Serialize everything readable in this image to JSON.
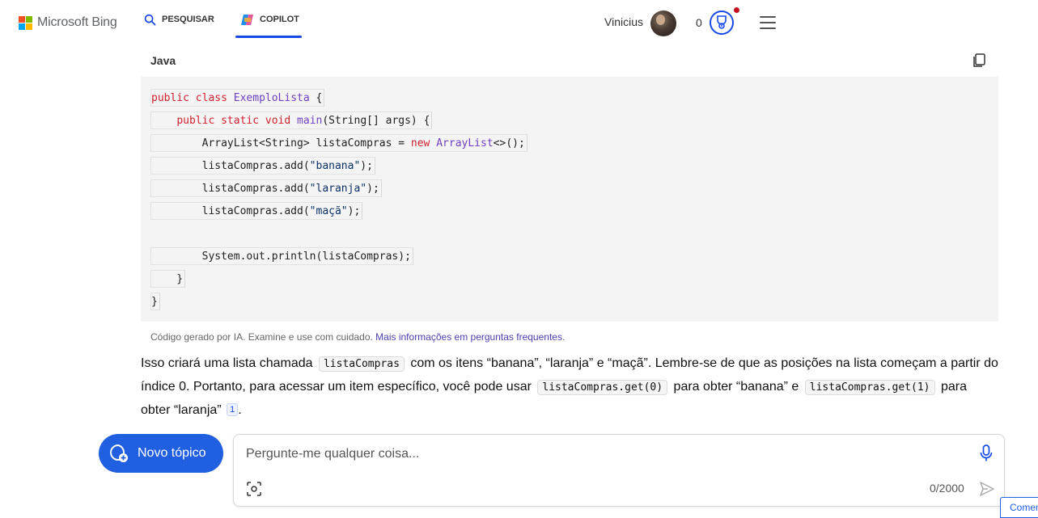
{
  "header": {
    "logo_text": "Microsoft Bing",
    "tabs": [
      {
        "label": "PESQUISAR",
        "icon": "search-icon",
        "active": false
      },
      {
        "label": "COPILOT",
        "icon": "copilot-icon",
        "active": true
      }
    ],
    "user_name": "Vinicius",
    "points": "0",
    "accent_color": "#174ae4"
  },
  "code_block": {
    "language": "Java",
    "lines": [
      "public class ExemploLista {",
      "    public static void main(String[] args) {",
      "        ArrayList<String> listaCompras = new ArrayList<>();",
      "        listaCompras.add(\"banana\");",
      "        listaCompras.add(\"laranja\");",
      "        listaCompras.add(\"maçã\");",
      "",
      "        System.out.println(listaCompras);",
      "    }",
      "}"
    ],
    "disclaimer": "Código gerado por IA. Examine e use com cuidado.",
    "disclaimer_link": "Mais informações em perguntas frequentes",
    "disclaimer_end": "."
  },
  "answer": {
    "part1": "Isso criará uma lista chamada",
    "code1": "listaCompras",
    "part2": "com os itens “banana”, “laranja” e “maçã”. Lembre-se de que as posições na lista começam a partir do índice 0. Portanto, para acessar um item específico, você pode usar",
    "code2": "listaCompras.get(0)",
    "part3": "para obter “banana” e",
    "code3": "listaCompras.get(1)",
    "part4": "para obter “laranja”",
    "citation": "1",
    "end": "."
  },
  "composer": {
    "new_topic_label": "Novo tópico",
    "placeholder": "Pergunte-me qualquer coisa...",
    "counter": "0/2000"
  },
  "feedback_label": "Comentários"
}
